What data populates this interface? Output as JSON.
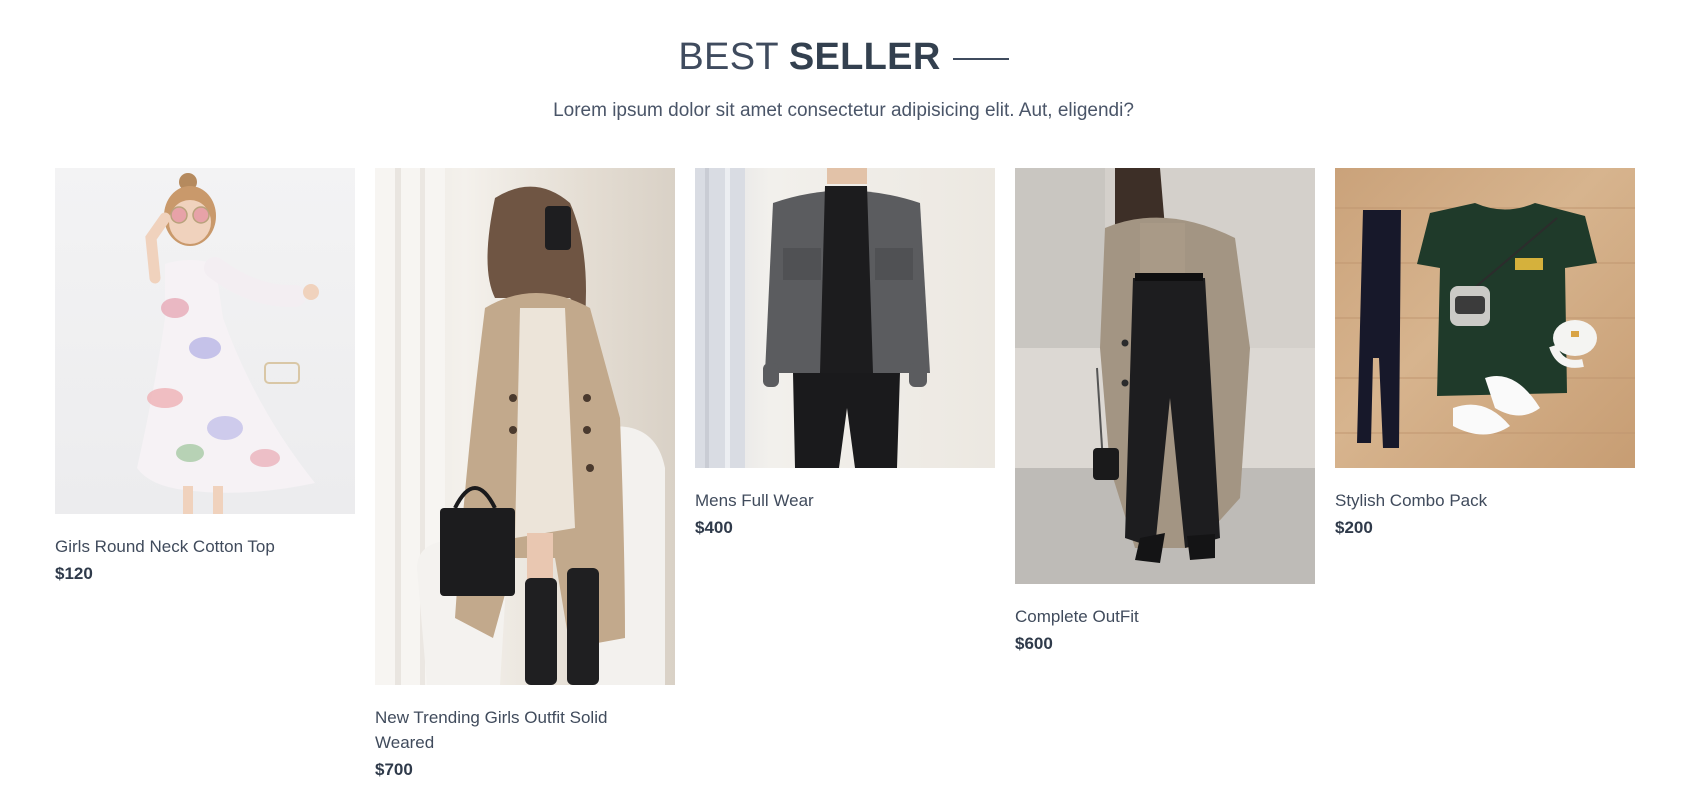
{
  "section": {
    "title_light": "BEST",
    "title_bold": "SELLER",
    "subtitle": "Lorem ipsum dolor sit amet consectetur adipisicing elit. Aut, eligendi?"
  },
  "products": [
    {
      "name": "Girls Round Neck Cotton Top",
      "price": "$120",
      "image_icon": "girl-floral-dress-photo"
    },
    {
      "name": "New Trending Girls Outfit Solid Weared",
      "price": "$700",
      "image_icon": "woman-trench-coat-photo"
    },
    {
      "name": "Mens Full Wear",
      "price": "$400",
      "image_icon": "man-grey-jacket-photo"
    },
    {
      "name": "Complete OutFit",
      "price": "$600",
      "image_icon": "woman-long-coat-photo"
    },
    {
      "name": "Stylish Combo Pack",
      "price": "$200",
      "image_icon": "flatlay-combo-photo"
    }
  ]
}
